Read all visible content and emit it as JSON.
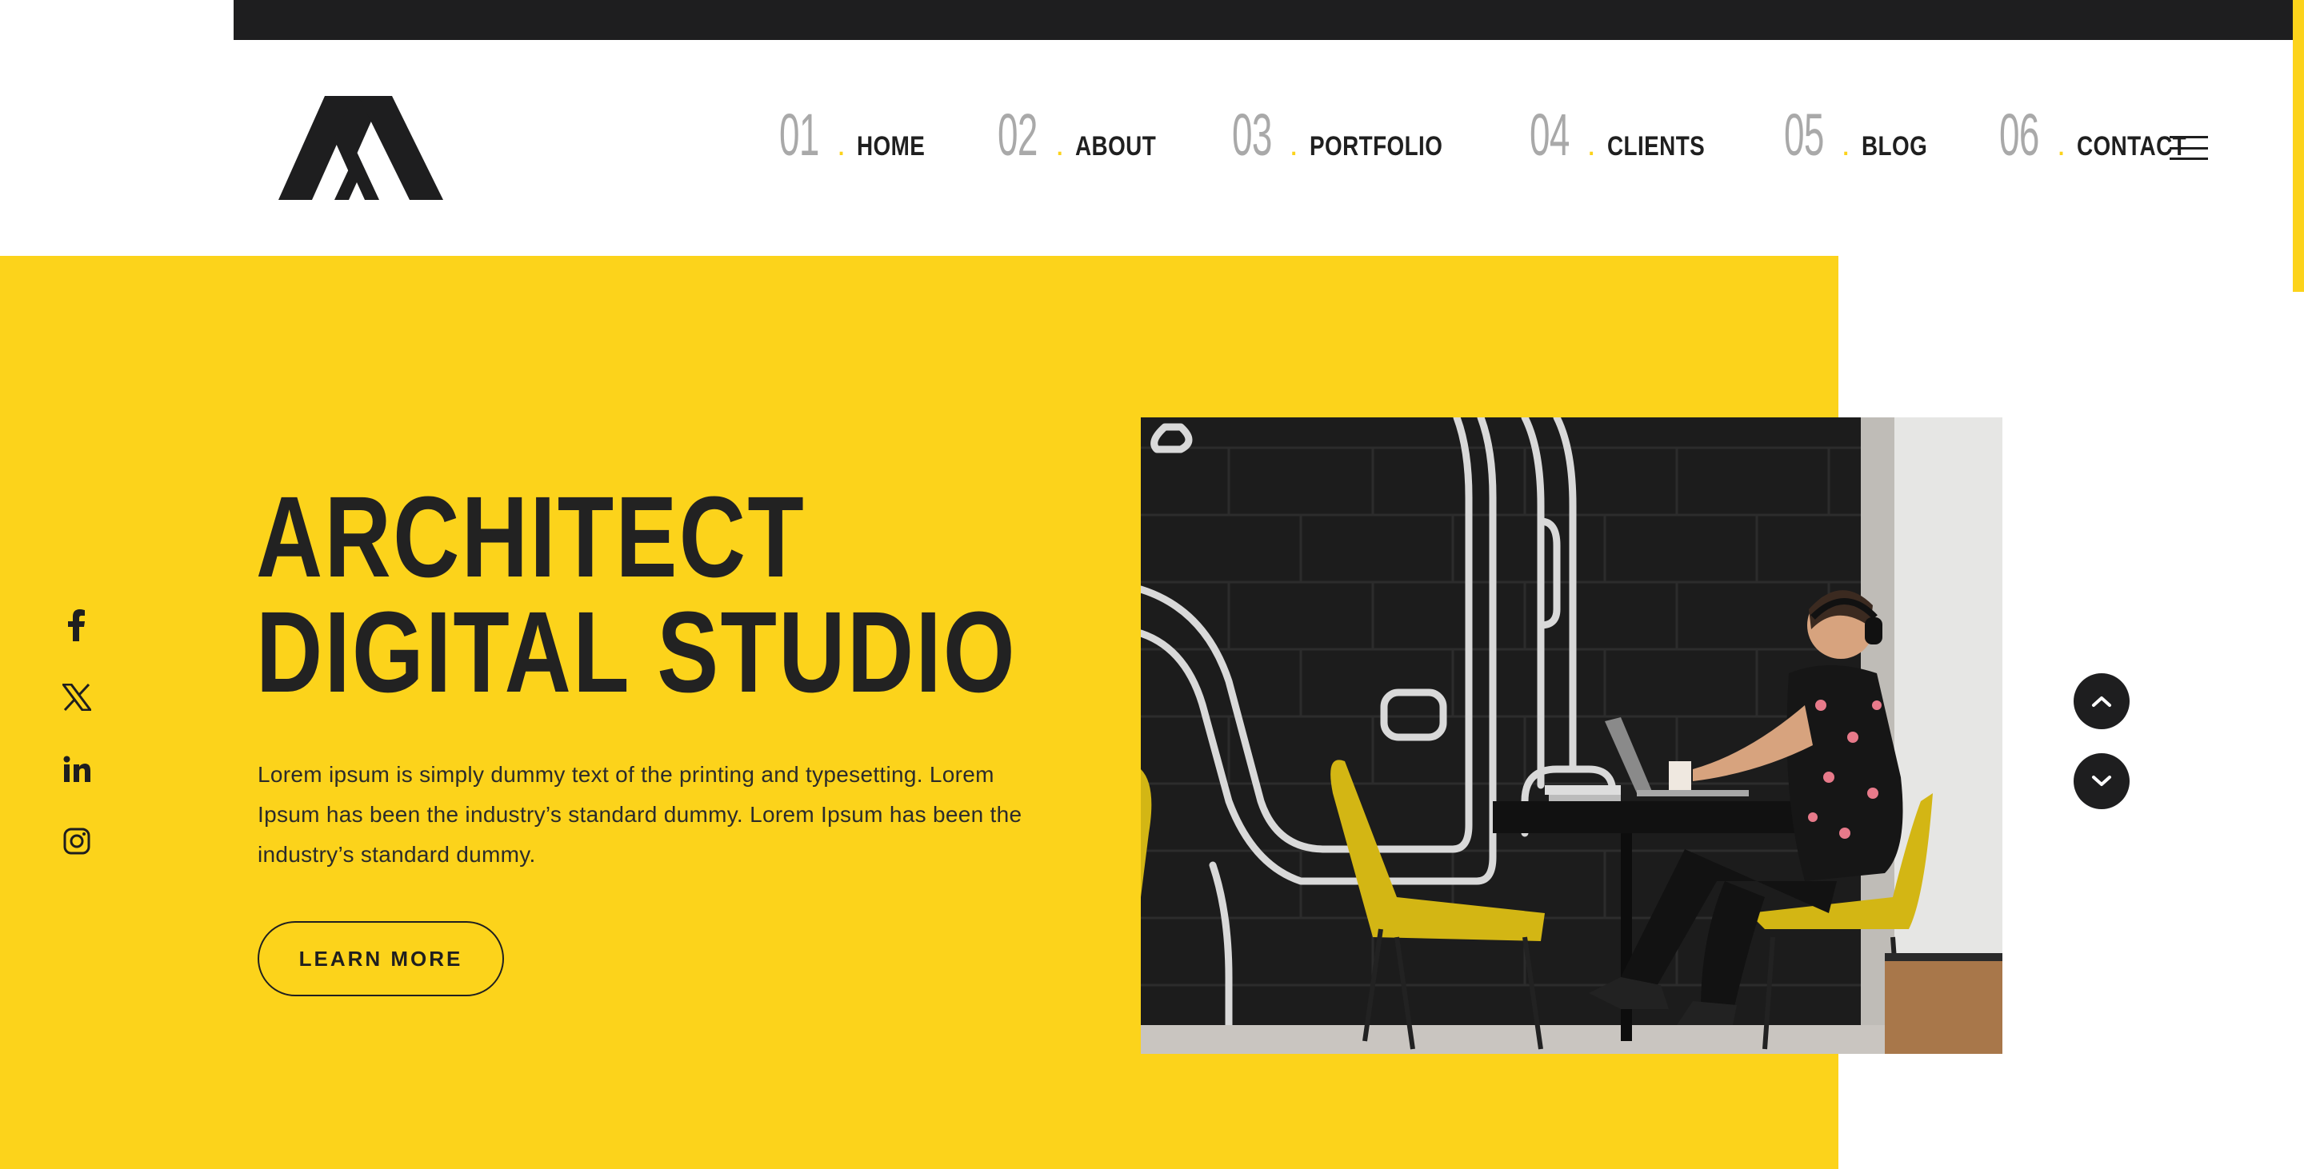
{
  "header": {
    "logo_icon": "monogram-logo-icon",
    "nav": [
      {
        "num": "01",
        "dot": ".",
        "label": "HOME"
      },
      {
        "num": "02",
        "dot": ".",
        "label": "ABOUT"
      },
      {
        "num": "03",
        "dot": ".",
        "label": "PORTFOLIO"
      },
      {
        "num": "04",
        "dot": ".",
        "label": "CLIENTS"
      },
      {
        "num": "05",
        "dot": ".",
        "label": "BLOG"
      },
      {
        "num": "06",
        "dot": ".",
        "label": "CONTACT"
      }
    ],
    "menu_icon": "hamburger-icon"
  },
  "hero": {
    "headline_line1": "ARCHITECT",
    "headline_line2": "DIGITAL STUDIO",
    "description": "Lorem ipsum is simply dummy text of the printing and typesetting. Lorem Ipsum has been the industry’s standard dummy. Lorem Ipsum has been the industry’s standard dummy.",
    "cta_label": "LEARN MORE",
    "image_alt": "man-with-headphones-working-on-laptop-photo"
  },
  "social": [
    "facebook-icon",
    "x-twitter-icon",
    "linkedin-icon",
    "instagram-icon"
  ],
  "slider": {
    "prev_icon": "chevron-up-icon",
    "next_icon": "chevron-down-icon"
  },
  "colors": {
    "accent": "#fcd31b",
    "dark": "#1e1e1f",
    "muted": "#a9a9a9",
    "white": "#ffffff"
  }
}
